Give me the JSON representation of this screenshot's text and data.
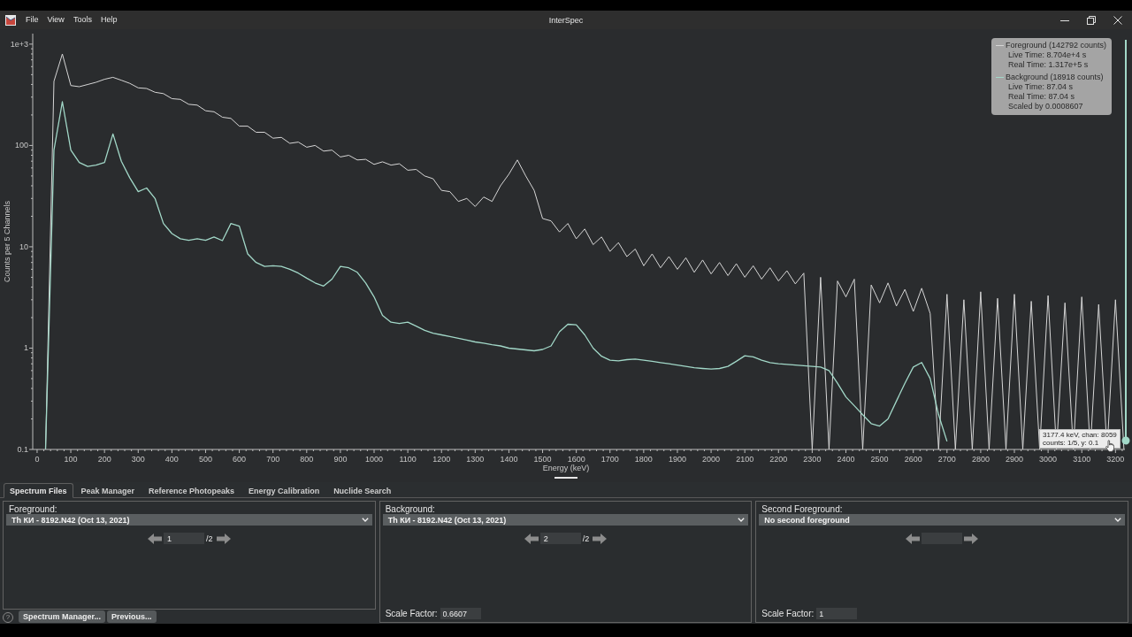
{
  "window": {
    "title": "InterSpec",
    "menu": [
      "File",
      "View",
      "Tools",
      "Help"
    ]
  },
  "chart": {
    "chart_data": [
      {
        "type": "line",
        "xlabel": "Energy (keV)",
        "ylabel": "Counts per 5 Channels",
        "log": true,
        "xlim": [
          -13,
          3228
        ],
        "ylim": [
          0.1,
          1270
        ],
        "xticks": [
          0,
          100,
          200,
          300,
          400,
          500,
          600,
          700,
          800,
          900,
          1000,
          1100,
          1200,
          1300,
          1400,
          1500,
          1600,
          1700,
          1800,
          1900,
          2000,
          2100,
          2200,
          2300,
          2400,
          2500,
          2600,
          2700,
          2800,
          2900,
          3000,
          3100,
          3200
        ],
        "yticks": [
          {
            "value": 0.1,
            "label": "0.1"
          },
          {
            "value": 1,
            "label": "1"
          },
          {
            "value": 10,
            "label": "10"
          },
          {
            "value": 100,
            "label": "100"
          },
          {
            "value": 1000,
            "label": "1e+3"
          }
        ],
        "x": [
          25,
          50,
          75,
          100,
          125,
          150,
          175,
          200,
          225,
          250,
          275,
          300,
          325,
          350,
          375,
          400,
          425,
          450,
          475,
          500,
          525,
          550,
          575,
          600,
          625,
          650,
          675,
          700,
          725,
          750,
          775,
          800,
          825,
          850,
          875,
          900,
          925,
          950,
          975,
          1000,
          1025,
          1050,
          1075,
          1100,
          1125,
          1150,
          1175,
          1200,
          1225,
          1250,
          1275,
          1300,
          1325,
          1350,
          1375,
          1400,
          1425,
          1450,
          1475,
          1500,
          1525,
          1550,
          1575,
          1600,
          1625,
          1650,
          1675,
          1700,
          1725,
          1750,
          1775,
          1800,
          1825,
          1850,
          1875,
          1900,
          1925,
          1950,
          1975,
          2000,
          2025,
          2050,
          2075,
          2100,
          2125,
          2150,
          2175,
          2200,
          2225,
          2250,
          2275,
          2300,
          2325,
          2350,
          2375,
          2400,
          2425,
          2450,
          2475,
          2500,
          2525,
          2550,
          2575,
          2600,
          2625,
          2650,
          2675,
          2700,
          2725,
          2750,
          2775,
          2800,
          2825,
          2850,
          2875,
          2900,
          2925,
          2950,
          2975,
          3000,
          3025,
          3050,
          3075,
          3100,
          3125,
          3150,
          3175,
          3200,
          3225
        ],
        "series": [
          {
            "color": "#d6d6d6",
            "values": [
              0.1,
              430,
              800,
              390,
              380,
              400,
              420,
              450,
              470,
              440,
              410,
              370,
              365,
              335,
              325,
              290,
              285,
              255,
              250,
              220,
              215,
              190,
              185,
              155,
              155,
              135,
              135,
              118,
              120,
              105,
              108,
              96,
              100,
              88,
              90,
              77,
              80,
              72,
              73,
              65,
              69,
              64,
              66,
              57,
              58,
              50,
              47,
              36,
              35,
              28,
              30,
              25,
              31,
              28,
              40,
              52,
              72,
              50,
              36,
              19,
              18,
              14,
              17,
              12,
              15,
              10.5,
              12.5,
              9,
              11,
              8,
              9.5,
              6.5,
              8.5,
              6.2,
              8,
              6,
              7.8,
              5.6,
              7.4,
              5.4,
              7,
              5.2,
              6.8,
              5,
              6.5,
              4.8,
              6.2,
              4.6,
              5.8,
              4.3,
              5.5,
              0.1,
              5,
              0.1,
              4.6,
              3.2,
              4.8,
              0.1,
              4.2,
              2.8,
              4.4,
              2.6,
              3.8,
              2.3,
              3.9,
              2.2,
              0.1,
              3.4,
              0.1,
              3,
              0.1,
              3.6,
              0.1,
              3.1,
              0.1,
              3.4,
              0.1,
              2.9,
              0.1,
              3.3,
              0.1,
              2.8,
              0.1,
              3.2,
              0.1,
              2.7,
              0.1,
              3,
              0.1
            ]
          },
          {
            "color": "#a2d8c8",
            "values": [
              0.1,
              90,
              270,
              90,
              68,
              62,
              64,
              68,
              130,
              70,
              48,
              35,
              38,
              30,
              17,
              13.5,
              12,
              11.6,
              12,
              11.6,
              12.5,
              11.5,
              17,
              16,
              8.5,
              7,
              6.4,
              6.5,
              6.4,
              6,
              5.5,
              4.9,
              4.4,
              4.1,
              4.8,
              6.4,
              6.2,
              5.6,
              4.4,
              3.2,
              2.1,
              1.8,
              1.75,
              1.8,
              1.65,
              1.5,
              1.4,
              1.35,
              1.3,
              1.25,
              1.2,
              1.15,
              1.12,
              1.08,
              1.05,
              1,
              0.98,
              0.96,
              0.94,
              0.97,
              1.05,
              1.45,
              1.72,
              1.7,
              1.35,
              1,
              0.83,
              0.76,
              0.75,
              0.77,
              0.78,
              0.76,
              0.74,
              0.72,
              0.7,
              0.68,
              0.66,
              0.64,
              0.63,
              0.62,
              0.63,
              0.66,
              0.74,
              0.84,
              0.82,
              0.76,
              0.72,
              0.7,
              0.69,
              0.68,
              0.67,
              0.66,
              0.65,
              0.6,
              0.45,
              0.33,
              0.27,
              0.22,
              0.18,
              0.17,
              0.2,
              0.3,
              0.45,
              0.65,
              0.72,
              0.5,
              0.22,
              0.12,
              null,
              null,
              null,
              null,
              null,
              null,
              null,
              null,
              null,
              null,
              null,
              null,
              null,
              null,
              null,
              null,
              null,
              null,
              null,
              null,
              null
            ]
          }
        ]
      }
    ],
    "legend": [
      {
        "title": "Foreground (142792 counts)",
        "lines": [
          "Live Time: 8.704e+4 s",
          "Real Time: 1.317e+5 s"
        ]
      },
      {
        "title": "Background (18918 counts)",
        "lines": [
          "Live Time: 87.04 s",
          "Real Time: 87.04 s",
          "Scaled by 0.0008607"
        ]
      }
    ],
    "cursor_readout": [
      "3177.4 keV, chan: 8059",
      "counts: 1/5, y: 0.1"
    ]
  },
  "tabs": [
    {
      "label": "Spectrum Files",
      "selected": true
    },
    {
      "label": "Peak Manager",
      "selected": false
    },
    {
      "label": "Reference Photopeaks",
      "selected": false
    },
    {
      "label": "Energy Calibration",
      "selected": false
    },
    {
      "label": "Nuclide Search",
      "selected": false
    }
  ],
  "panels": [
    {
      "label": "Foreground:",
      "file": "Th КИ - 8192.N42 (Oct 13, 2021)",
      "sample": "1",
      "sample_count": "/2"
    },
    {
      "label": "Background:",
      "file": "Th КИ - 8192.N42 (Oct 13, 2021)",
      "sample": "2",
      "sample_count": "/2",
      "scale_factor": {
        "label": "Scale Factor:",
        "value": "0.6607"
      }
    },
    {
      "label": "Second Foreground:",
      "file": "No second foreground",
      "scale_factor": {
        "label": "Scale Factor:",
        "value": "1"
      }
    }
  ],
  "help": "?",
  "panel_buttons": [
    "Spectrum Manager...",
    "Previous..."
  ]
}
